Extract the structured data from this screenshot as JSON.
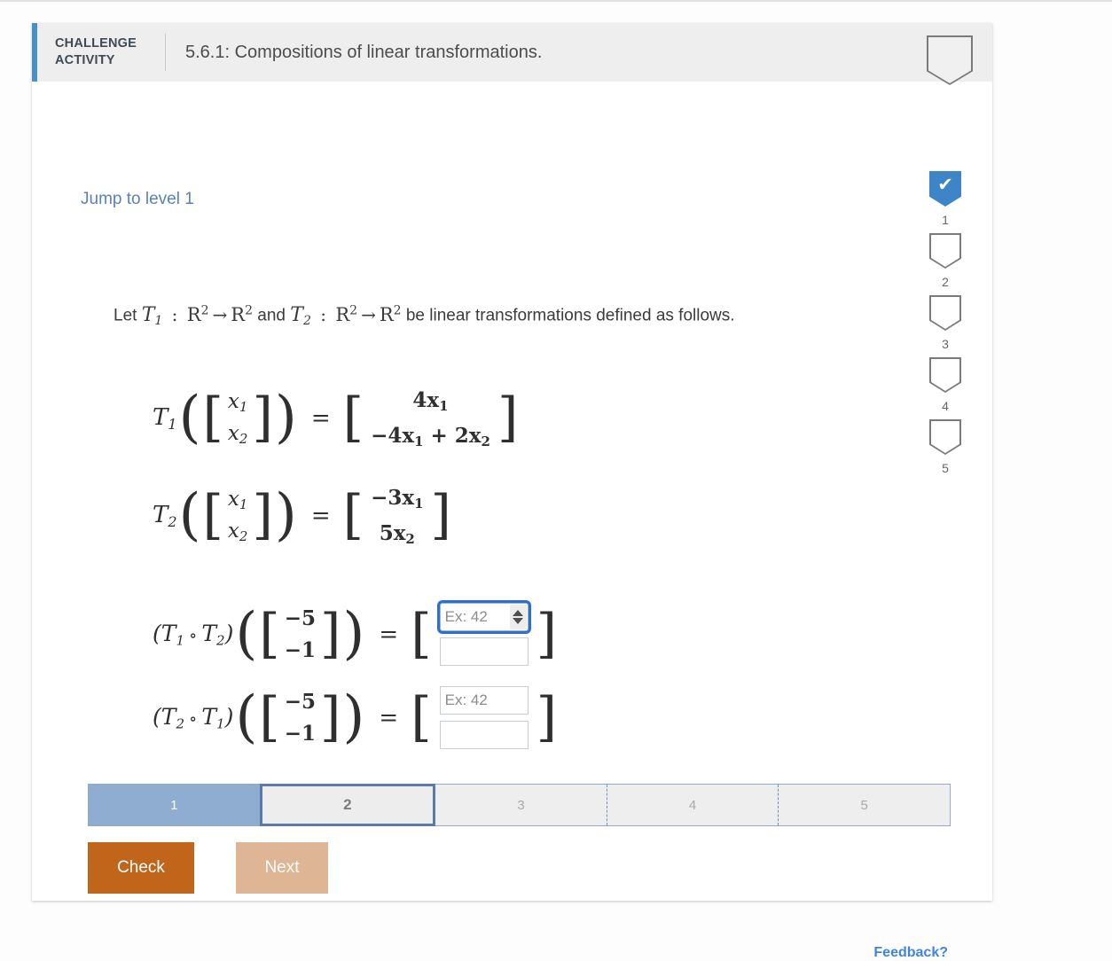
{
  "header": {
    "kicker_line1": "CHALLENGE",
    "kicker_line2": "ACTIVITY",
    "title": "5.6.1: Compositions of linear transformations.",
    "badge_icon": "shield-outline-icon",
    "accent_color": "#4a90c4",
    "background": "#eeeeee"
  },
  "body": {
    "jump_link": "Jump to level 1",
    "intro": {
      "lead": "Let",
      "t1": "T",
      "t1_sub": "1",
      "colon": " : ",
      "domain": "R",
      "domain_sup": "2",
      "arrow": "→",
      "codomain": "R",
      "codomain_sup": "2",
      "and": "and",
      "t2": "T",
      "t2_sub": "2",
      "tail": "be linear transformations defined as follows."
    },
    "definitions": [
      {
        "name": "T",
        "name_sub": "1",
        "arg_rows": [
          "x",
          "x"
        ],
        "arg_subs": [
          "1",
          "2"
        ],
        "result_rows": [
          "4x",
          "−4x"
        ],
        "result_row1": "4x",
        "result_row1_sub": "1",
        "result_row2_a": "−4x",
        "result_row2_a_sub": "1",
        "result_row2_b": " + 2x",
        "result_row2_b_sub": "2"
      },
      {
        "name": "T",
        "name_sub": "2",
        "result_row1": "−3x",
        "result_row1_sub": "1",
        "result_row2": "5x",
        "result_row2_sub": "2"
      }
    ],
    "compositions": [
      {
        "label_first": "T",
        "label_first_sub": "1",
        "ring": "∘",
        "label_second": "T",
        "label_second_sub": "2",
        "input_row1": "−5",
        "input_row2": "−1",
        "answer_top_value": "",
        "answer_top_placeholder": "Ex: 42",
        "answer_bottom_value": "",
        "answer_bottom_placeholder": "",
        "focused": "top",
        "has_spinner": true
      },
      {
        "label_first": "T",
        "label_first_sub": "2",
        "ring": "∘",
        "label_second": "T",
        "label_second_sub": "1",
        "input_row1": "−5",
        "input_row2": "−1",
        "answer_top_value": "",
        "answer_top_placeholder": "Ex: 42",
        "answer_bottom_value": "",
        "answer_bottom_placeholder": "",
        "focused": "none",
        "has_spinner": false
      }
    ],
    "equals": "=",
    "levels": [
      {
        "number": "1",
        "state": "done",
        "icon": "check-icon"
      },
      {
        "number": "2",
        "state": "empty",
        "icon": "shield-outline-icon"
      },
      {
        "number": "3",
        "state": "empty",
        "icon": "shield-outline-icon"
      },
      {
        "number": "4",
        "state": "empty",
        "icon": "shield-outline-icon"
      },
      {
        "number": "5",
        "state": "empty",
        "icon": "shield-outline-icon"
      }
    ],
    "progress_steps": [
      {
        "label": "1",
        "state": "done"
      },
      {
        "label": "2",
        "state": "current"
      },
      {
        "label": "3",
        "state": "upcoming"
      },
      {
        "label": "4",
        "state": "upcoming"
      },
      {
        "label": "5",
        "state": "upcoming"
      }
    ],
    "buttons": {
      "check": "Check",
      "next": "Next",
      "check_color": "#c1651a",
      "next_color": "#dfb695"
    },
    "feedback": "Feedback?"
  }
}
